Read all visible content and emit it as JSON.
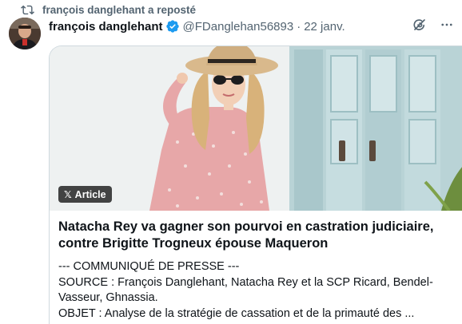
{
  "repost": {
    "icon": "repost-icon",
    "text": "françois danglehant a reposté"
  },
  "tweet": {
    "author_name": "françois danglehant",
    "verified_icon": "verified-badge-icon",
    "handle": "@FDanglehan56893",
    "separator": "·",
    "date": "22 janv.",
    "actions": [
      "grok-icon",
      "more-icon"
    ]
  },
  "card": {
    "badge_label": "Article",
    "badge_icon": "x-logo-icon",
    "title": "Natacha Rey va gagner son pourvoi en castration judiciaire, contre Brigitte Trogneux épouse Maqueron",
    "lines": {
      "line1": "--- COMMUNIQUÉ DE PRESSE ---",
      "line2": "SOURCE : François Danglehant, Natacha Rey et la SCP Ricard, Bendel-Vasseur, Ghnassia.",
      "line3": "OBJET : Analyse de la stratégie de cassation et de la primauté des ..."
    }
  },
  "colors": {
    "text": "#0f1419",
    "secondary": "#536471",
    "verified": "#1d9bf0",
    "border": "#cfd9de"
  }
}
